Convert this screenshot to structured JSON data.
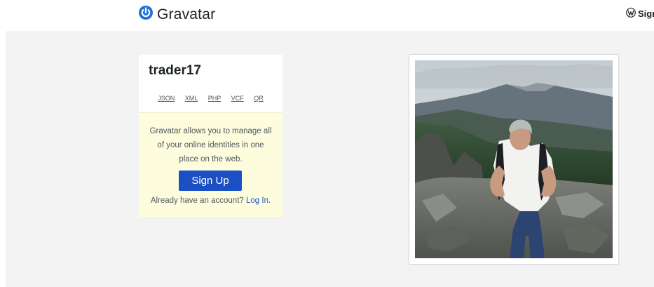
{
  "header": {
    "logo_text": "Gravatar",
    "signin_label": "Sign"
  },
  "profile": {
    "username": "trader17",
    "formats": [
      "JSON",
      "XML",
      "PHP",
      "VCF",
      "QR"
    ]
  },
  "promo": {
    "text": "Gravatar allows you to manage all of your online identities in one place on the web.",
    "signup_label": "Sign Up",
    "login_prompt": "Already have an account?",
    "login_link": "Log In",
    "login_suffix": "."
  },
  "colors": {
    "brand_blue": "#1d4fc4",
    "promo_bg": "#fdfdde",
    "page_bg": "#f3f3f3"
  },
  "icons": {
    "logo": "gravatar-power-icon",
    "signin": "wordpress-icon"
  }
}
